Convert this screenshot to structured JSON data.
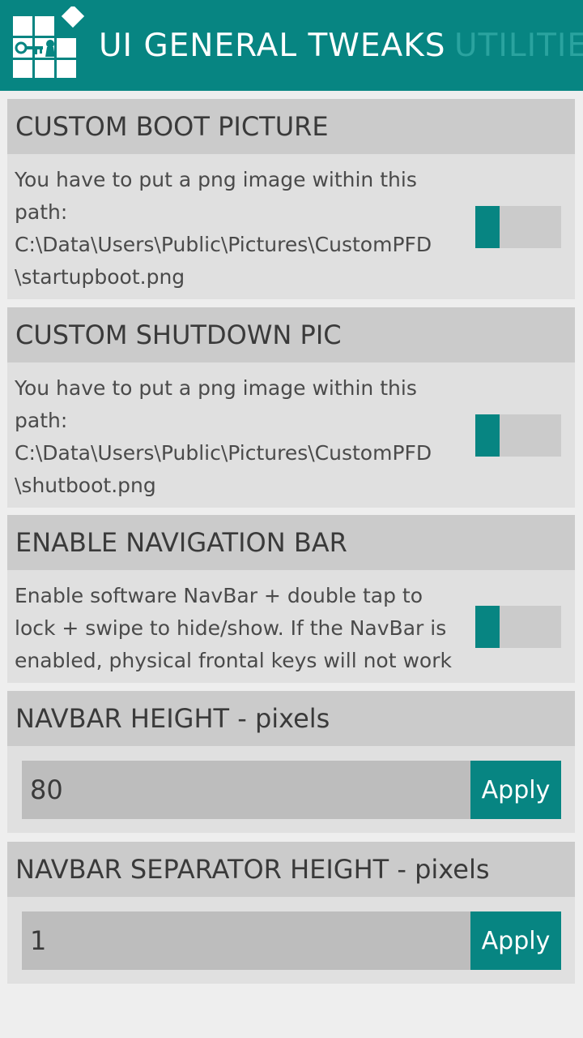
{
  "header": {
    "pivot_active": "UI GENERAL TWEAKS",
    "pivot_inactive": "UTILITIES",
    "accent_color": "#078582"
  },
  "sections": {
    "boot": {
      "title": "CUSTOM BOOT PICTURE",
      "desc": [
        "You have to put a png image within this",
        "path:",
        "C:\\Data\\Users\\Public\\Pictures\\CustomPFD",
        "\\startupboot.png"
      ],
      "toggle_on": false
    },
    "shutdown": {
      "title": "CUSTOM SHUTDOWN PIC",
      "desc": [
        "You have to put a png image within this",
        "path:",
        "C:\\Data\\Users\\Public\\Pictures\\CustomPFD",
        "\\shutboot.png"
      ],
      "toggle_on": false
    },
    "navbar": {
      "title": "ENABLE NAVIGATION BAR",
      "desc": [
        "Enable software NavBar + double tap to",
        "lock + swipe to hide/show. If the NavBar is",
        "enabled, physical frontal keys will not work"
      ],
      "toggle_on": false
    },
    "navbar_height": {
      "title": "NAVBAR HEIGHT - pixels",
      "value": "80",
      "apply_label": "Apply"
    },
    "separator_height": {
      "title": "NAVBAR SEPARATOR HEIGHT - pixels",
      "value": "1",
      "apply_label": "Apply"
    }
  }
}
